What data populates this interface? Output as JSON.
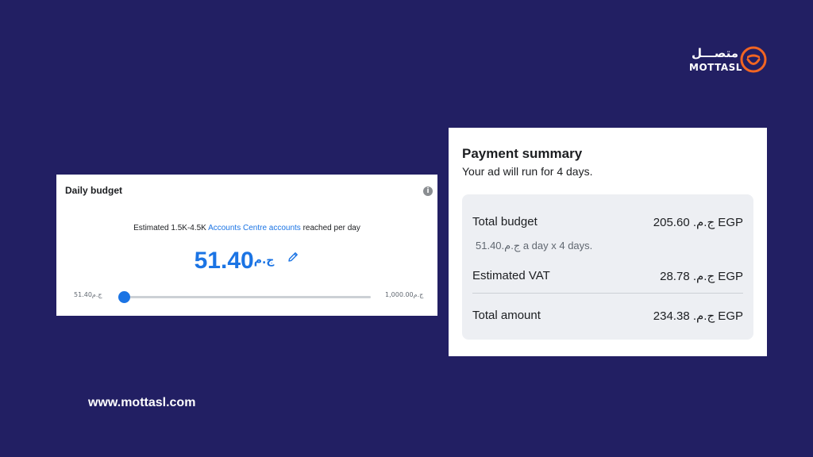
{
  "brand": {
    "name_ar": "متصـــل",
    "name_en": "MOTTASL",
    "accent_color": "#f26522",
    "background_color": "#221f63",
    "website": "www.mottasl.com"
  },
  "daily_budget": {
    "title": "Daily budget",
    "info_icon": "i",
    "estimate_prefix": "Estimated 1.5K-4.5K ",
    "estimate_link": "Accounts Centre accounts",
    "estimate_suffix": " reached per day",
    "currency": "ج.م",
    "amount": "51.40",
    "slider_min_label": "ج.م51.40",
    "slider_max_label": "ج.م1,000.00",
    "slider_value_fraction": 0,
    "accent_color": "#1b74e4"
  },
  "payment_summary": {
    "title": "Payment summary",
    "subtitle": "Your ad will run for 4 days.",
    "total_budget_label": "Total budget",
    "total_budget_value": "205.60 .ج.م EGP",
    "budget_note": "51.40.ج.م a day x 4 days.",
    "vat_label": "Estimated VAT",
    "vat_value": "28.78 .ج.م EGP",
    "total_amount_label": "Total amount",
    "total_amount_value": "234.38 .ج.م EGP"
  }
}
